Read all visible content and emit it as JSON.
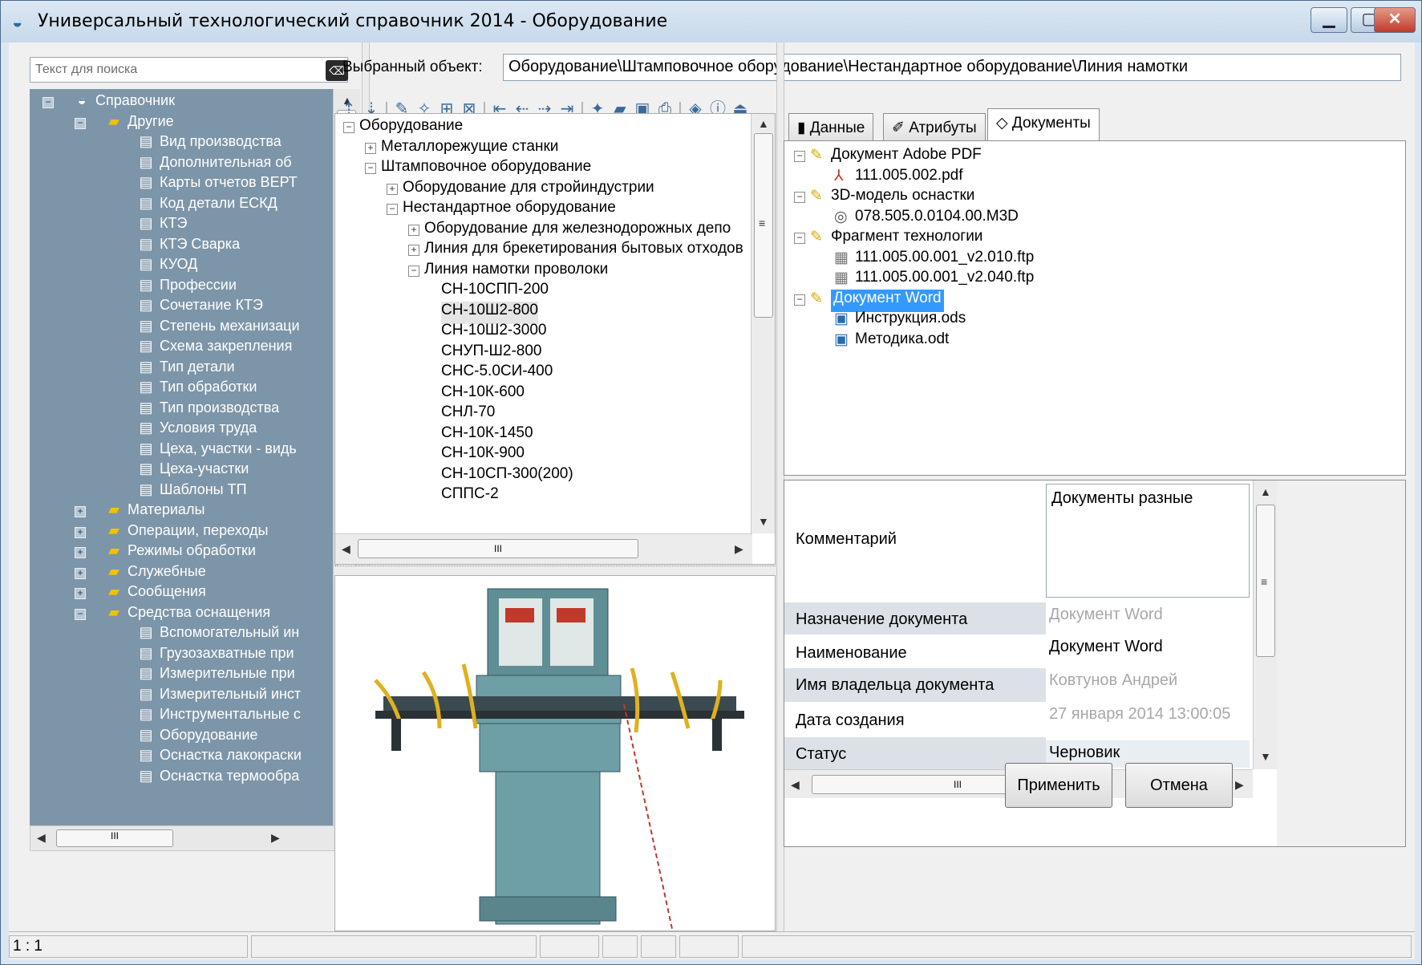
{
  "window": {
    "title": "Универсальный технологический справочник 2014 - Оборудование",
    "minimize": "▁",
    "maximize": "▢",
    "close": "✕"
  },
  "search": {
    "placeholder": "Текст для поиска",
    "value": ""
  },
  "left_tree": {
    "root": "Справочник",
    "group_other": "Другие",
    "other_items": [
      "Вид производства",
      "Дополнительная об",
      "Карты отчетов ВЕРТ",
      "Код детали ЕСКД",
      "КТЭ",
      "КТЭ Сварка",
      "КУОД",
      "Профессии",
      "Сочетание КТЭ",
      "Степень механизаци",
      "Схема закрепления",
      "Тип детали",
      "Тип обработки",
      "Тип производства",
      "Условия труда",
      "Цеха, участки - видь",
      "Цеха-участки",
      "Шаблоны ТП"
    ],
    "groups": [
      "Материалы",
      "Операции, переходы",
      "Режимы обработки",
      "Служебные",
      "Сообщения"
    ],
    "group_tools": "Средства оснащения",
    "tools_items": [
      "Вспомогательный ин",
      "Грузозахватные при",
      "Измерительные при",
      "Измерительный инст",
      "Инструментальные с",
      "Оборудование",
      "Оснастка лакокраски",
      "Оснастка термообра"
    ]
  },
  "selected_object": {
    "label": "Выбранный объект:",
    "value": "Оборудование\\Штамповочное оборудование\\Нестандартное оборудование\\Линия намотки"
  },
  "middle_tree": {
    "rows": [
      {
        "text": "Оборудование",
        "level": 0,
        "exp": "−"
      },
      {
        "text": "Металлорежущие станки",
        "level": 1,
        "exp": "+"
      },
      {
        "text": "Штамповочное оборудование",
        "level": 1,
        "exp": "−"
      },
      {
        "text": "Оборудование для стройиндустрии",
        "level": 2,
        "exp": "+"
      },
      {
        "text": "Нестандартное оборудование",
        "level": 2,
        "exp": "−"
      },
      {
        "text": "Оборудование для железнодорожных депо",
        "level": 3,
        "exp": "+"
      },
      {
        "text": "Линия для брекетирования бытовых отходов",
        "level": 3,
        "exp": "+"
      },
      {
        "text": "Линия намотки проволоки",
        "level": 3,
        "exp": "−"
      },
      {
        "text": "СН-10СПП-200",
        "level": 4,
        "exp": ""
      },
      {
        "text": "СН-10Ш2-800",
        "level": 4,
        "exp": "",
        "selected": true
      },
      {
        "text": "СН-10Ш2-3000",
        "level": 4,
        "exp": ""
      },
      {
        "text": "СНУП-Ш2-800",
        "level": 4,
        "exp": ""
      },
      {
        "text": "СНС-5.0СИ-400",
        "level": 4,
        "exp": ""
      },
      {
        "text": "СН-10К-600",
        "level": 4,
        "exp": ""
      },
      {
        "text": "СНЛ-70",
        "level": 4,
        "exp": ""
      },
      {
        "text": "СН-10К-1450",
        "level": 4,
        "exp": ""
      },
      {
        "text": "СН-10К-900",
        "level": 4,
        "exp": ""
      },
      {
        "text": "СН-10СП-300(200)",
        "level": 4,
        "exp": ""
      },
      {
        "text": "СППС-2",
        "level": 4,
        "exp": ""
      }
    ]
  },
  "tabs": [
    "Данные",
    "Атрибуты",
    "Документы"
  ],
  "active_tab": "Документы",
  "doc_tree": {
    "rows": [
      {
        "text": "Документ Adobe PDF",
        "level": 0,
        "kind": "folder"
      },
      {
        "text": "111.005.002.pdf",
        "level": 1,
        "kind": "pdf"
      },
      {
        "text": "3D-модель оснастки",
        "level": 0,
        "kind": "folder"
      },
      {
        "text": "078.505.0.0104.00.M3D",
        "level": 1,
        "kind": "m3d"
      },
      {
        "text": "Фрагмент технологии",
        "level": 0,
        "kind": "folder"
      },
      {
        "text": "111.005.00.001_v2.010.ftp",
        "level": 1,
        "kind": "ftp"
      },
      {
        "text": "111.005.00.001_v2.040.ftp",
        "level": 1,
        "kind": "ftp"
      },
      {
        "text": "Документ Word",
        "level": 0,
        "kind": "folder",
        "selected": true
      },
      {
        "text": "Инструкция.ods",
        "level": 1,
        "kind": "doc"
      },
      {
        "text": "Методика.odt",
        "level": 1,
        "kind": "doc"
      }
    ]
  },
  "properties": {
    "comment_label": "Комментарий",
    "comment_value": "Документы разные",
    "purpose_label": "Назначение документа",
    "purpose_value": "Документ Word",
    "name_label": "Наименование",
    "name_value": "Документ Word",
    "owner_label": "Имя владельца документа",
    "owner_value": "Ковтунов Андрей",
    "created_label": "Дата создания",
    "created_value": "27 января 2014 13:00:05",
    "status_label": "Статус",
    "status_value": "Черновик"
  },
  "buttons": {
    "apply": "Применить",
    "cancel": "Отмена"
  },
  "statusbar": {
    "position": "1 : 1"
  },
  "scroll": {
    "hscroll_mark": "III"
  }
}
